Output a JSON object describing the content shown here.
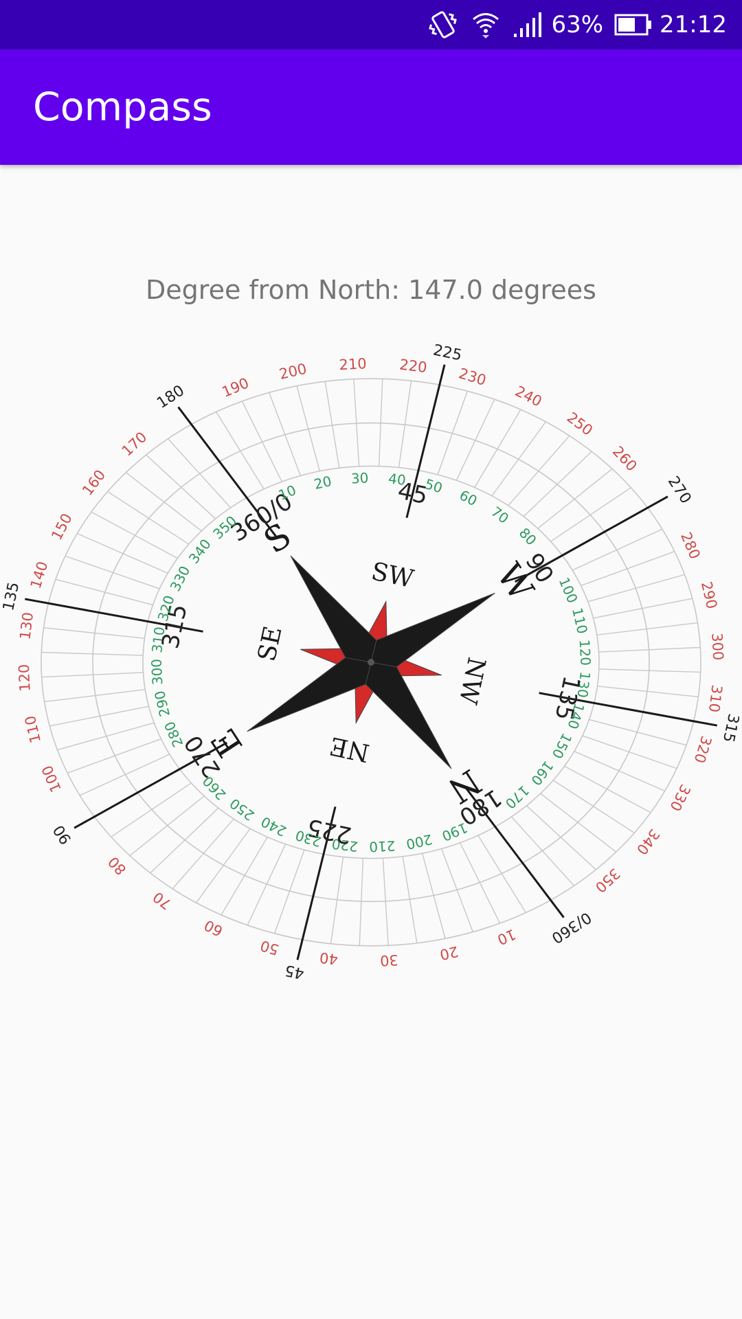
{
  "status_bar": {
    "battery_percent": "63%",
    "time": "21:12",
    "icons": [
      "vibrate-icon",
      "wifi-icon",
      "signal-icon",
      "battery-icon"
    ]
  },
  "app_bar": {
    "title": "Compass"
  },
  "reading": {
    "text": "Degree from North: 147.0 degrees",
    "heading_degrees": 147.0
  },
  "compass": {
    "rotation_degrees": 147.0,
    "cardinals": [
      "N",
      "E",
      "S",
      "W"
    ],
    "intercardinals": [
      "NE",
      "SE",
      "SW",
      "NW"
    ],
    "outer_ring_labels": [
      "0/360",
      "10",
      "20",
      "30",
      "40",
      "45",
      "50",
      "60",
      "70",
      "80",
      "90",
      "100",
      "110",
      "120",
      "130",
      "135",
      "140",
      "150",
      "160",
      "170",
      "180",
      "190",
      "200",
      "210",
      "220",
      "225",
      "230",
      "240",
      "250",
      "260",
      "270",
      "280",
      "290",
      "300",
      "310",
      "315",
      "320",
      "330",
      "340",
      "350"
    ],
    "inner_ring_labels": [
      "360/0",
      "10",
      "20",
      "30",
      "40",
      "45",
      "50",
      "60",
      "70",
      "80",
      "90",
      "100",
      "110",
      "120",
      "130",
      "135",
      "140",
      "150",
      "160",
      "170",
      "180",
      "190",
      "200",
      "210",
      "220",
      "225",
      "230",
      "240",
      "250",
      "260",
      "270",
      "280",
      "290",
      "300",
      "310",
      "315",
      "320",
      "330",
      "340",
      "350"
    ],
    "colors": {
      "outer_labels": "#d04a4a",
      "inner_labels": "#2e9a5e",
      "major_labels": "#222222",
      "ticks": "#c8c8c8",
      "star_dark": "#1a1a1a",
      "star_red": "#d42a2a"
    }
  }
}
